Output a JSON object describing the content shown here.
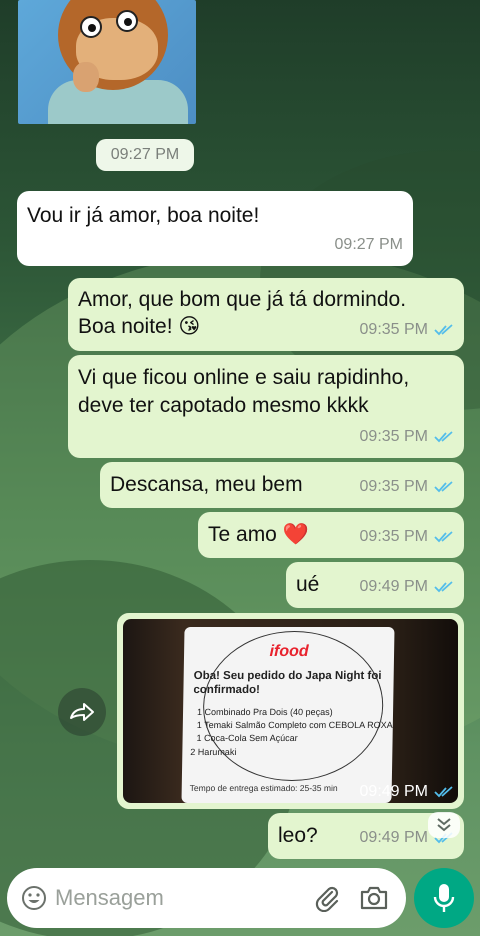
{
  "theme": {
    "incoming_bubble": "#ffffff",
    "outgoing_bubble": "#e3f5cf",
    "read_tick": "#53bdeb",
    "mic_button": "#00a884"
  },
  "sticker": {
    "icon": "monkey-puppet-sticker"
  },
  "messages": [
    {
      "direction": "incoming",
      "time_pill": "09:27 PM"
    },
    {
      "direction": "incoming",
      "text": "Vou ir já amor, boa noite!",
      "time": "09:27 PM"
    },
    {
      "direction": "outgoing",
      "text_line1": "Amor, que bom que já tá dormindo.",
      "text_line2": "Boa noite! 😘",
      "time": "09:35 PM",
      "status": "read"
    },
    {
      "direction": "outgoing",
      "text_line1": "Vi que ficou online e saiu rapidinho,",
      "text_line2": "deve ter capotado mesmo kkkk",
      "time": "09:35 PM",
      "status": "read"
    },
    {
      "direction": "outgoing",
      "text": "Descansa, meu bem",
      "time": "09:35 PM",
      "status": "read"
    },
    {
      "direction": "outgoing",
      "text": "Te amo ❤️",
      "time": "09:35 PM",
      "status": "read"
    },
    {
      "direction": "outgoing",
      "text": "ué",
      "time": "09:49 PM",
      "status": "read"
    },
    {
      "direction": "outgoing",
      "type": "image",
      "time": "09:49 PM",
      "status": "read",
      "image": {
        "brand": "ifood",
        "headline": "Oba! Seu pedido do Japa Night foi confirmado!",
        "items": [
          "1 Combinado Pra Dois (40 peças)",
          "1 Temaki Salmão Completo com CEBOLA ROXA",
          "1 Coca-Cola Sem Açúcar",
          "2 Harumaki"
        ],
        "eta": "Tempo de entrega estimado: 25-35 min"
      }
    },
    {
      "direction": "outgoing",
      "text": "leo?",
      "time": "09:49 PM",
      "status": "read"
    }
  ],
  "composer": {
    "placeholder": "Mensagem",
    "emoji_icon": "emoji-icon",
    "attach_icon": "paperclip-icon",
    "camera_icon": "camera-icon",
    "mic_icon": "microphone-icon"
  },
  "floating": {
    "forward_icon": "forward-icon",
    "scroll_icon": "chevron-double-down-icon"
  }
}
